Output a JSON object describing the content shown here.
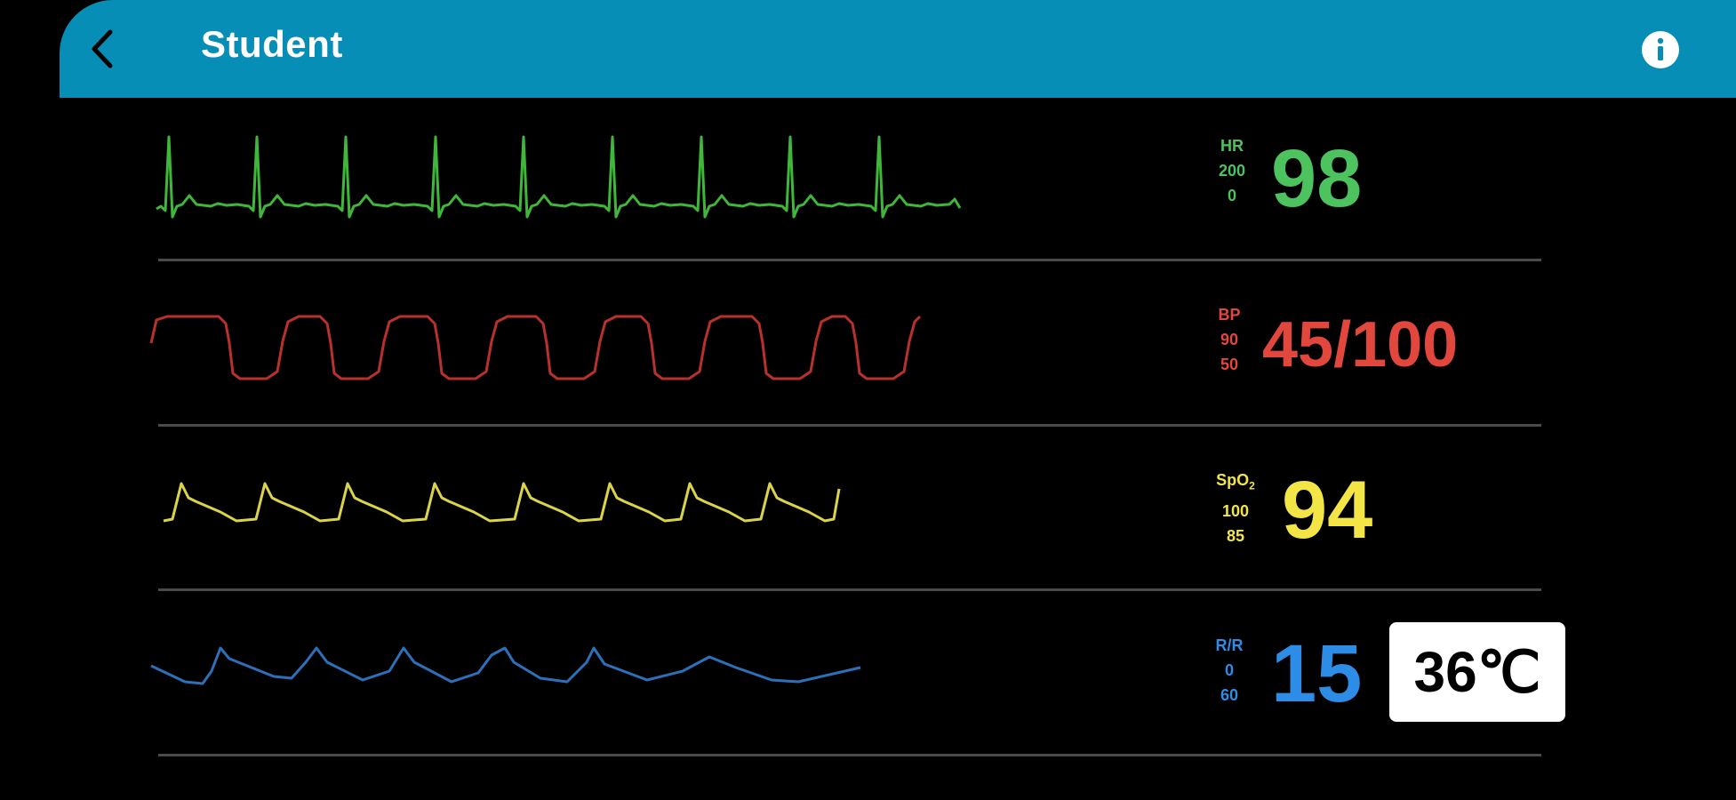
{
  "header": {
    "title": "Student",
    "background": "#078eb6",
    "back_icon": "chevron-left-icon",
    "info_icon": "info-icon"
  },
  "channels": [
    {
      "id": "hr",
      "label": "HR",
      "scale_top": "200",
      "scale_bottom": "0",
      "value": "98",
      "color": "#4cc35e",
      "waveform": "ecg"
    },
    {
      "id": "bp",
      "label": "BP",
      "scale_top": "90",
      "scale_bottom": "50",
      "value": "45/100",
      "color": "#e2473d",
      "waveform": "arterial-pressure"
    },
    {
      "id": "spo2",
      "label_main": "SpO",
      "label_sub": "2",
      "scale_top": "100",
      "scale_bottom": "85",
      "value": "94",
      "color": "#f3e545",
      "waveform": "pleth"
    },
    {
      "id": "rr",
      "label": "R/R",
      "scale_top": "0",
      "scale_bottom": "60",
      "value": "15",
      "color": "#2c8ce6",
      "waveform": "respiration"
    }
  ],
  "temperature": {
    "value": "36℃"
  }
}
